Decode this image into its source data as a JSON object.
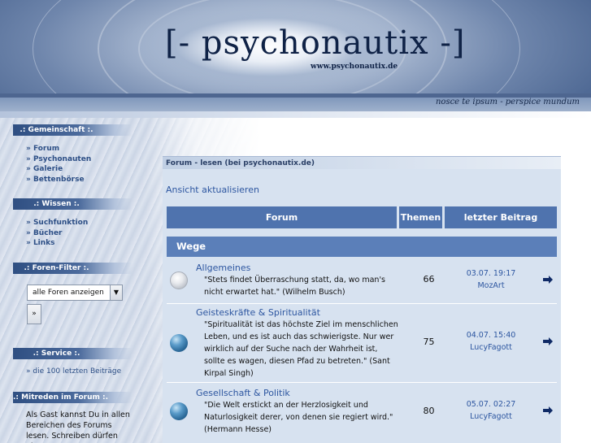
{
  "header": {
    "logo": "[- psychonautix -]",
    "logo_url": "www.psychonautix.de",
    "tagline": "nosce te ipsum - perspice mundum"
  },
  "sidebar": {
    "community": {
      "title": ".: Gemeinschaft :.",
      "items": [
        "» Forum",
        "» Psychonauten",
        "» Galerie",
        "» Bettenbörse"
      ]
    },
    "knowledge": {
      "title": ".: Wissen :.",
      "items": [
        "» Suchfunktion",
        "» Bücher",
        "» Links"
      ]
    },
    "filter": {
      "title": ".: Foren-Filter :.",
      "select_value": "alle Foren anzeigen",
      "go_label": "»"
    },
    "service": {
      "title": ".: Service :.",
      "item": "» die 100 letzten Beiträge"
    },
    "participate": {
      "title": ".: Mitreden im Forum :.",
      "text": "Als Gast kannst Du in allen Bereichen des Forums lesen. Schreiben dürfen aber nur"
    }
  },
  "forum": {
    "panel_title": "Forum - lesen (bei psychonautix.de)",
    "refresh_link": "Ansicht aktualisieren",
    "columns": [
      "Forum",
      "Themen",
      "letzter Beitrag"
    ],
    "category": "Wege",
    "rows": [
      {
        "name": "Allgemeines",
        "description": "\"Stets findet Überraschung statt, da, wo man's nicht erwartet hat.\" (Wilhelm Busch)",
        "topics": "66",
        "last_date": "03.07. 19:17",
        "last_user": "MozArt",
        "icon": "forum-read-icon"
      },
      {
        "name": "Geisteskräfte & Spiritualität",
        "description": "\"Spiritualität ist das höchste Ziel im menschlichen Leben, und es ist auch das schwierigste. Nur wer wirklich auf der Suche nach der Wahrheit ist, sollte es wagen, diesen Pfad zu betreten.\" (Sant Kirpal Singh)",
        "topics": "75",
        "last_date": "04.07. 15:40",
        "last_user": "LucyFagott",
        "icon": "forum-new-icon"
      },
      {
        "name": "Gesellschaft & Politik",
        "description": "\"Die Welt erstickt an der Herzlosigkeit und Naturlosigkeit derer, von denen sie regiert wird.\" (Hermann Hesse)",
        "topics": "80",
        "last_date": "05.07. 02:27",
        "last_user": "LucyFagott",
        "icon": "forum-new-icon"
      }
    ]
  },
  "colors": {
    "header_dark": "#4f73ae",
    "link": "#2d56a0",
    "panel_bg": "#d7e2f0"
  }
}
